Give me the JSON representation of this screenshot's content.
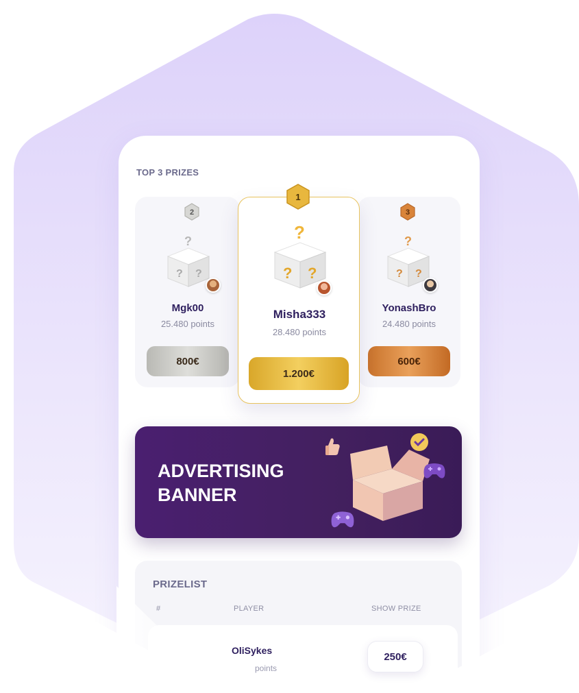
{
  "colors": {
    "hex_bg": "#e3dafb",
    "brand_purple": "#4a1f70",
    "gold": "#e3b43a",
    "silver": "#c9c9c4",
    "bronze": "#d48a3c",
    "text_dark": "#2e1f5e"
  },
  "top_prizes": {
    "title": "TOP 3 PRIZES",
    "entries": [
      {
        "rank": "2",
        "player": "Mgk00",
        "points": "25.480 points",
        "prize": "800€",
        "tier": "silver",
        "icon": "mystery-box-icon"
      },
      {
        "rank": "1",
        "player": "Misha333",
        "points": "28.480 points",
        "prize": "1.200€",
        "tier": "gold",
        "icon": "mystery-box-icon"
      },
      {
        "rank": "3",
        "player": "YonashBro",
        "points": "24.480 points",
        "prize": "600€",
        "tier": "bronze",
        "icon": "mystery-box-icon"
      }
    ]
  },
  "ad": {
    "line1": "ADVERTISING",
    "line2": "BANNER",
    "icons": [
      "open-box-icon",
      "gamepad-icon",
      "thumbs-up-icon",
      "check-badge-icon"
    ]
  },
  "prizelist": {
    "title": "PRIZELIST",
    "columns": {
      "rank": "#",
      "player": "PLAYER",
      "prize": "SHOW PRIZE"
    },
    "rows": [
      {
        "player": "OliSykes",
        "points": "points",
        "prize": "250€"
      }
    ]
  }
}
